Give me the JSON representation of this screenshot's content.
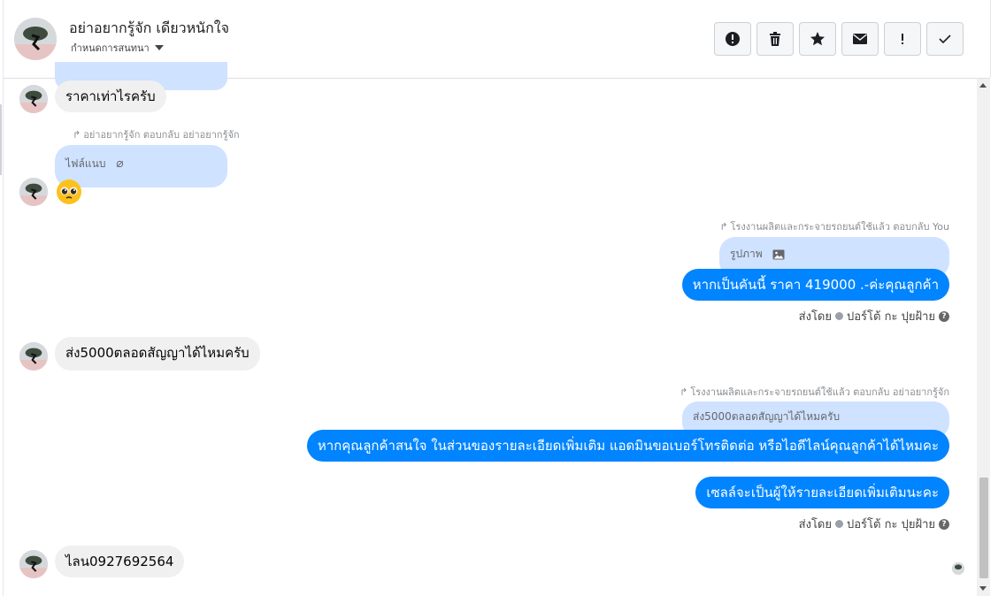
{
  "header": {
    "name": "อย่าอยากรู้จัก เดียวหนักใจ",
    "subtitle": "กำหนดการสนทนา"
  },
  "toolbar": [
    {
      "name": "alert-button",
      "icon": "alert-circle-icon"
    },
    {
      "name": "delete-button",
      "icon": "trash-icon"
    },
    {
      "name": "star-button",
      "icon": "star-icon"
    },
    {
      "name": "mail-button",
      "icon": "envelope-icon"
    },
    {
      "name": "important-button",
      "icon": "exclamation-icon"
    },
    {
      "name": "done-button",
      "icon": "check-icon"
    }
  ],
  "messages": {
    "m1": "ราคาเท่าไรครับ",
    "m2_meta": "อย่าอยากรู้จัก ตอบกลับ อย่าอยากรู้จัก",
    "m2_reply": "ไฟล์แนบ",
    "m3_meta": "โรงงานผลิตและกระจายรถยนต์ใช้แล้ว ตอบกลับ You",
    "m3_reply": "รูปภาพ",
    "m3": "หากเป็นคันนี้ ราคา 419000 .-ค่ะคุณลูกค้า",
    "m3_sentby_label": "ส่งโดย",
    "m3_sentby_name": "ปอร์โต้ กะ ปุยฝ้าย",
    "m4": "ส่ง5000ตลอดสัญญาได้ไหมครับ",
    "m5_meta": "โรงงานผลิตและกระจายรถยนต์ใช้แล้ว ตอบกลับ อย่าอยากรู้จัก",
    "m5_reply": "ส่ง5000ตลอดสัญญาได้ไหมครับ",
    "m5": "หากคุณลูกค้าสนใจ ในส่วนของรายละเอียดเพิ่มเติม แอดมินขอเบอร์โทรติดต่อ หรือไอดีไลน์คุณลูกค้าได้ไหมคะ",
    "m6": "เซลล์จะเป็นผู้ให้รายละเอียดเพิ่มเติมนะคะ",
    "m6_sentby_label": "ส่งโดย",
    "m6_sentby_name": "ปอร์โต้ กะ ปุยฝ้าย",
    "m7": "ไลน0927692564"
  },
  "colors": {
    "outgoing": "#0084ff",
    "incoming": "#f0f0f0",
    "reply": "#cfe2ff"
  }
}
